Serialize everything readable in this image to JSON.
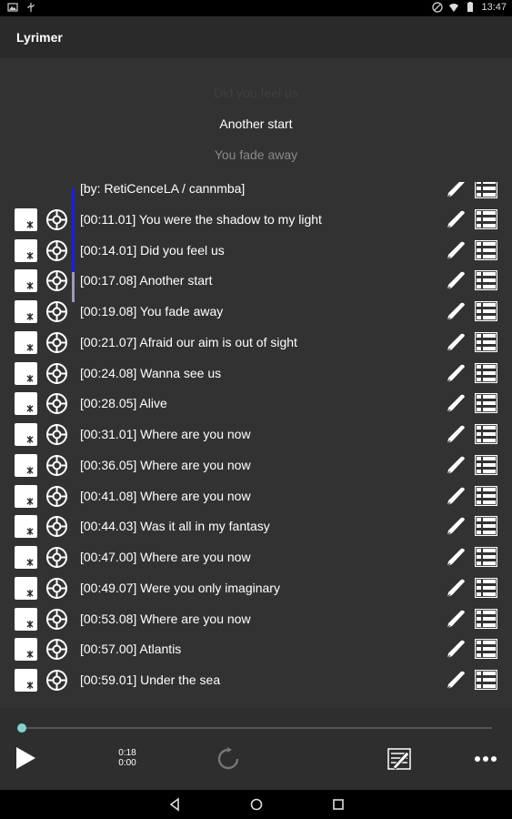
{
  "status_bar": {
    "time": "13:47",
    "icons_left": [
      "photo-icon",
      "usb-icon"
    ],
    "icons_right": [
      "dnd-icon",
      "wifi-icon",
      "battery-icon"
    ]
  },
  "app": {
    "title": "Lyrimer"
  },
  "preview": {
    "previous": "Did you feel us",
    "current": "Another start",
    "next": "You fade away"
  },
  "lyrics": [
    {
      "text": "[by: RetiCenceLA / cannmba]"
    },
    {
      "text": "[00:11.01] You were the shadow to my light"
    },
    {
      "text": "[00:14.01] Did you feel us"
    },
    {
      "text": "[00:17.08] Another start"
    },
    {
      "text": "[00:19.08] You fade away"
    },
    {
      "text": "[00:21.07] Afraid our aim is out of sight"
    },
    {
      "text": "[00:24.08] Wanna see us"
    },
    {
      "text": "[00:28.05] Alive"
    },
    {
      "text": "[00:31.01] Where are you now"
    },
    {
      "text": "[00:36.05] Where are you now"
    },
    {
      "text": "[00:41.08] Where are you now"
    },
    {
      "text": "[00:44.03] Was it all in my fantasy"
    },
    {
      "text": "[00:47.00] Where are you now"
    },
    {
      "text": "[00:49.07] Were you only imaginary"
    },
    {
      "text": "[00:53.08] Where are you now"
    },
    {
      "text": "[00:57.00] Atlantis"
    },
    {
      "text": "[00:59.01] Under the sea"
    }
  ],
  "player": {
    "position": "0:18",
    "duration": "0:00",
    "progress": 0.0
  },
  "colors": {
    "background": "#323232",
    "appbar": "#2a2a2a",
    "accent": "#7fd4d0",
    "scroll": "#1a1aff"
  }
}
